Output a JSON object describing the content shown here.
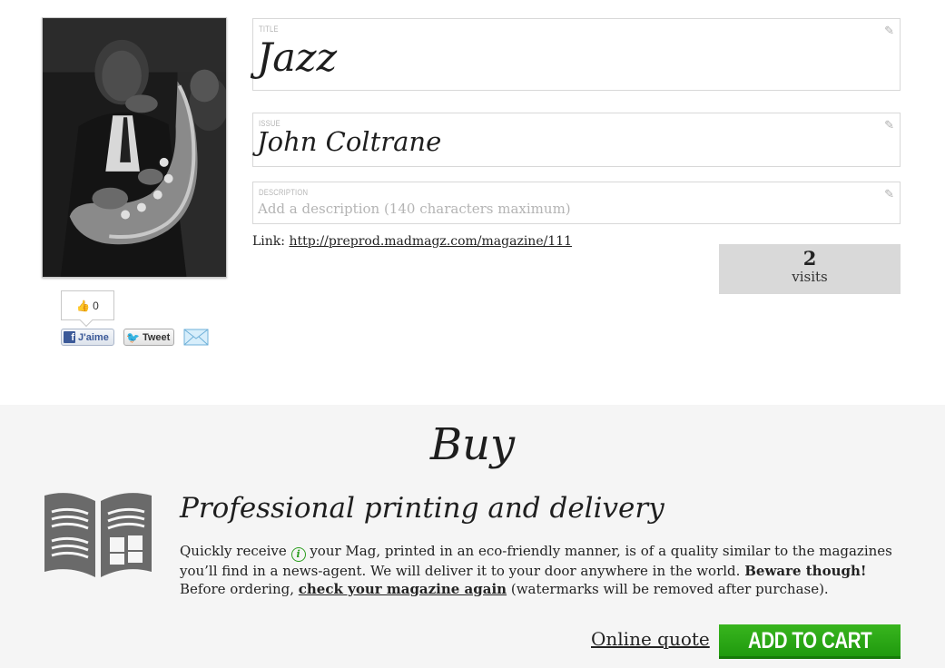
{
  "magazine": {
    "title_label": "TITLE",
    "title": "Jazz",
    "issue_label": "ISSUE",
    "issue": "John Coltrane",
    "description_label": "DESCRIPTION",
    "description_placeholder": "Add a description (140 characters maximum)",
    "link_prefix": "Link:",
    "link_url": "http://preprod.madmagz.com/magazine/111",
    "visits_count": "2",
    "visits_label": "visits"
  },
  "social": {
    "like_count": "0",
    "facebook_label": "J'aime",
    "tweet_label": "Tweet",
    "icons": [
      "thumbs-up-icon",
      "facebook-icon",
      "twitter-icon",
      "email-icon",
      "pencil-icon"
    ]
  },
  "buy": {
    "title": "Buy",
    "heading": "Professional printing and delivery",
    "desc_part1": "Quickly receive",
    "desc_part2": "your Mag, printed in an eco-friendly manner, is of a quality similar to the magazines you’ll find in a news-agent. We will deliver it to your door anywhere in the world.",
    "desc_bold": "Beware though!",
    "desc_part3": "Before ordering,",
    "desc_link": "check your magazine again",
    "desc_part4": "(watermarks will be removed after purchase).",
    "online_quote": "Online quote",
    "add_to_cart": "ADD TO CART"
  },
  "colors": {
    "cart_green": "#2aa714",
    "info_green": "#2a9d1d",
    "section_bg": "#f5f5f5",
    "visits_bg": "#d9d9d9"
  }
}
